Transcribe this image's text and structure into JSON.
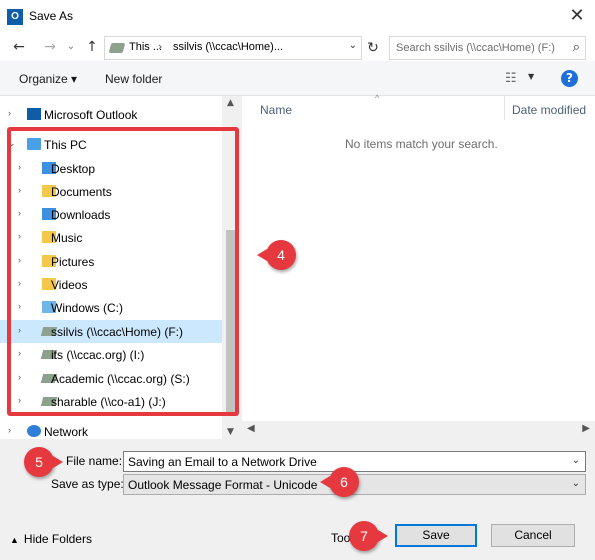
{
  "window": {
    "title": "Save As",
    "app_icon": "outlook-icon",
    "close_glyph": "✕"
  },
  "nav": {
    "back_glyph": "←",
    "forward_glyph": "→",
    "recent_glyph": "⌄",
    "up_glyph": "↑",
    "refresh_glyph": "↻",
    "address_crumb_1": "This ...",
    "address_sep": "›",
    "address_crumb_2": "ssilvis (\\\\ccac\\Home)...",
    "search_placeholder": "Search ssilvis (\\\\ccac\\Home) (F:)"
  },
  "toolbar": {
    "organize_label": "Organize ▾",
    "new_folder_label": "New folder",
    "help_glyph": "?"
  },
  "tree": [
    {
      "name": "tree-item-microsoft-outlook",
      "label": "Microsoft Outlook",
      "icon": "outlook",
      "chev": "›",
      "level": 0,
      "selected": false
    },
    {
      "name": "tree-item-this-pc",
      "label": "This PC",
      "icon": "pc",
      "chev": "⌄",
      "level": 0,
      "selected": false
    },
    {
      "name": "tree-item-desktop",
      "label": "Desktop",
      "icon": "folder-blue",
      "chev": "›",
      "level": 1,
      "selected": false
    },
    {
      "name": "tree-item-documents",
      "label": "Documents",
      "icon": "folder",
      "chev": "›",
      "level": 1,
      "selected": false
    },
    {
      "name": "tree-item-downloads",
      "label": "Downloads",
      "icon": "folder-blue",
      "chev": "›",
      "level": 1,
      "selected": false
    },
    {
      "name": "tree-item-music",
      "label": "Music",
      "icon": "folder",
      "chev": "›",
      "level": 1,
      "selected": false
    },
    {
      "name": "tree-item-pictures",
      "label": "Pictures",
      "icon": "folder",
      "chev": "›",
      "level": 1,
      "selected": false
    },
    {
      "name": "tree-item-videos",
      "label": "Videos",
      "icon": "folder",
      "chev": "›",
      "level": 1,
      "selected": false
    },
    {
      "name": "tree-item-windows-c",
      "label": "Windows (C:)",
      "icon": "drive-win",
      "chev": "›",
      "level": 1,
      "selected": false
    },
    {
      "name": "tree-item-ssilvis-f",
      "label": "ssilvis (\\\\ccac\\Home) (F:)",
      "icon": "net-drive",
      "chev": "›",
      "level": 1,
      "selected": true
    },
    {
      "name": "tree-item-its-i",
      "label": "its (\\\\ccac.org) (I:)",
      "icon": "net-drive",
      "chev": "›",
      "level": 1,
      "selected": false
    },
    {
      "name": "tree-item-academic-s",
      "label": "Academic (\\\\ccac.org) (S:)",
      "icon": "net-drive",
      "chev": "›",
      "level": 1,
      "selected": false
    },
    {
      "name": "tree-item-sharable-j",
      "label": "sharable (\\\\co-a1) (J:)",
      "icon": "net-drive",
      "chev": "›",
      "level": 1,
      "selected": false
    },
    {
      "name": "tree-item-network",
      "label": "Network",
      "icon": "network",
      "chev": "›",
      "level": 0,
      "selected": false
    }
  ],
  "file_list": {
    "col_name": "Name",
    "col_date": "Date modified",
    "sort_caret": "^",
    "empty_message": "No items match your search."
  },
  "scroll": {
    "up": "▲",
    "down": "▼",
    "left": "◀",
    "right": "▶"
  },
  "form": {
    "file_name_label": "File name:",
    "file_name_value": "Saving an Email to a Network Drive",
    "save_as_type_label": "Save as type:",
    "save_as_type_value": "Outlook Message Format - Unicode",
    "dropdown_glyph": "⌄"
  },
  "footer": {
    "hide_folders_caret": "▲",
    "hide_folders_label": "Hide Folders",
    "tools_label": "Too",
    "save_label": "Save",
    "cancel_label": "Cancel"
  },
  "annotations": {
    "callout_4": "4",
    "callout_5": "5",
    "callout_6": "6",
    "callout_7": "7",
    "color": "#e5393f"
  }
}
